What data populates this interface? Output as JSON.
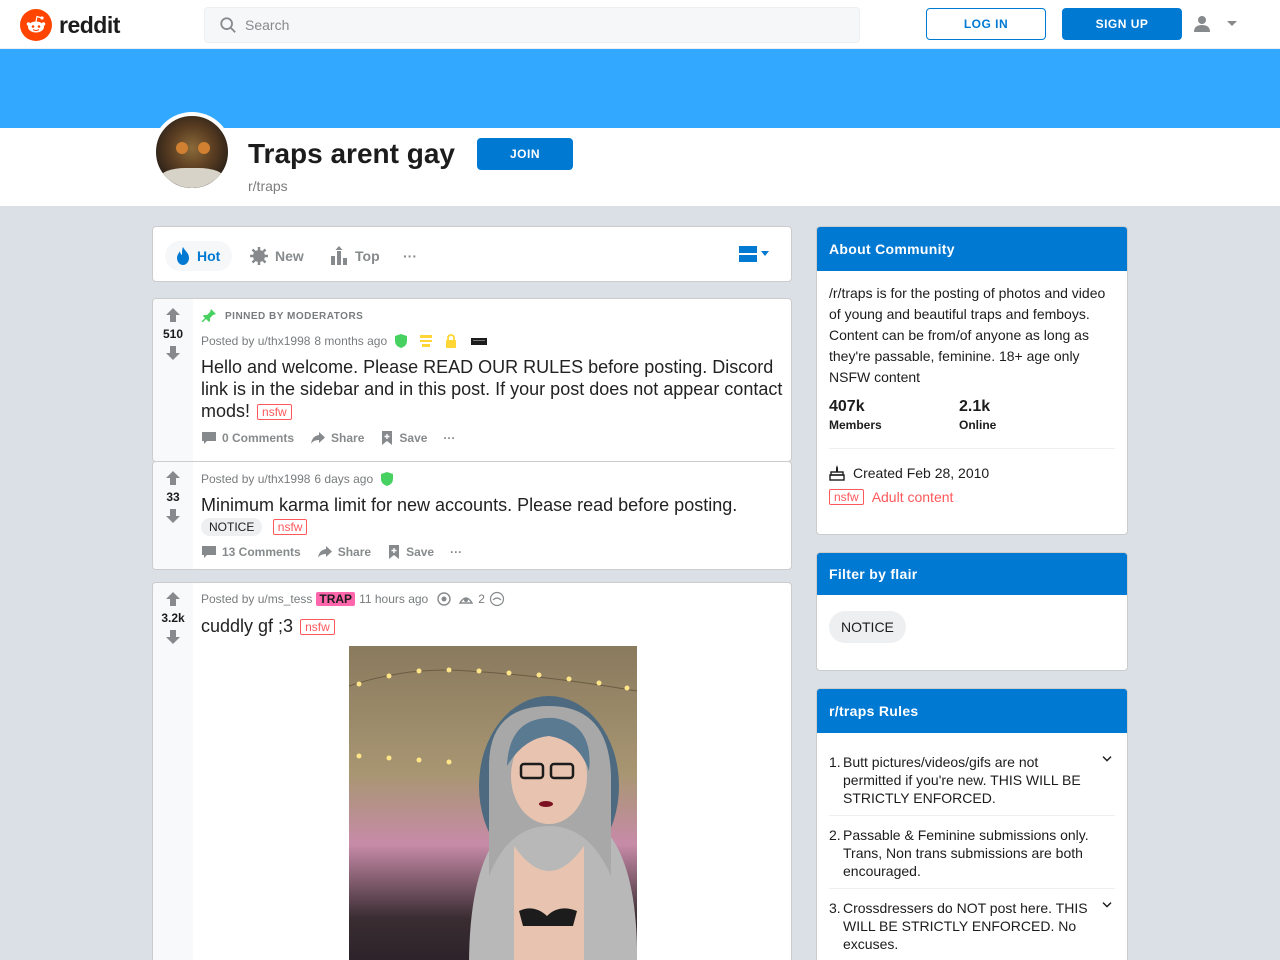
{
  "header": {
    "logo_text": "reddit",
    "search_placeholder": "Search",
    "login_label": "LOG IN",
    "signup_label": "SIGN UP"
  },
  "subreddit": {
    "title": "Traps arent gay",
    "name": "r/traps",
    "join_label": "JOIN",
    "banner_color": "#33a8ff"
  },
  "sort": {
    "hot": "Hot",
    "new": "New",
    "top": "Top",
    "more": "···"
  },
  "posts": [
    {
      "pinned_label": "PINNED BY MODERATORS",
      "votes": "510",
      "author": "Posted by u/thx1998",
      "time": "8 months ago",
      "title": "Hello and welcome. Please READ OUR RULES before posting. Discord link is in the sidebar and in this post. If your post does not appear contact mods!",
      "nsfw": "nsfw",
      "comments": "0 Comments",
      "share": "Share",
      "save": "Save",
      "more": "···"
    },
    {
      "votes": "33",
      "author": "Posted by u/thx1998",
      "time": "6 days ago",
      "title": "Minimum karma limit for new accounts. Please read before posting.",
      "flair": "NOTICE",
      "nsfw": "nsfw",
      "comments": "13 Comments",
      "share": "Share",
      "save": "Save",
      "more": "···"
    },
    {
      "votes": "3.2k",
      "author": "Posted by u/ms_tess",
      "user_flair": "TRAP",
      "time": "11 hours ago",
      "award_count": "2",
      "title": "cuddly gf ;3",
      "nsfw": "nsfw"
    }
  ],
  "about": {
    "heading": "About Community",
    "description": "/r/traps is for the posting of photos and video of young and beautiful traps and femboys. Content can be from/of anyone as long as they're passable, feminine. 18+ age only NSFW content",
    "members": "407k",
    "members_label": "Members",
    "online": "2.1k",
    "online_label": "Online",
    "created": "Created Feb 28, 2010",
    "nsfw": "nsfw",
    "adult": "Adult content"
  },
  "flair_filter": {
    "heading": "Filter by flair",
    "chip": "NOTICE"
  },
  "rules": {
    "heading": "r/traps Rules",
    "items": [
      {
        "num": "1.",
        "text": "Butt pictures/videos/gifs are not permitted if you're new. THIS WILL BE STRICTLY ENFORCED."
      },
      {
        "num": "2.",
        "text": "Passable & Feminine submissions only. Trans, Non trans submissions are both encouraged."
      },
      {
        "num": "3.",
        "text": "Crossdressers do NOT post here. THIS WILL BE STRICTLY ENFORCED. No excuses."
      }
    ]
  },
  "colors": {
    "accent": "#0079d3",
    "brand": "#ff4500",
    "nsfw": "#ff585b",
    "mod_shield": "#46d160",
    "flair_pink": "#ff66ac"
  }
}
